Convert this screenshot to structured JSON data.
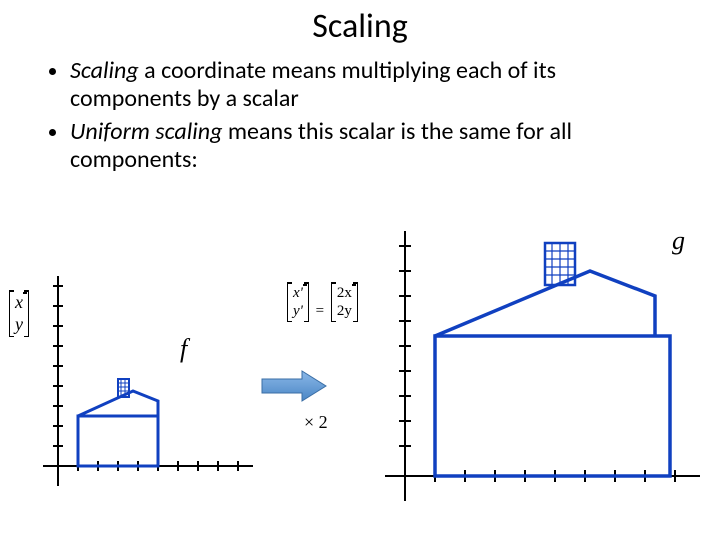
{
  "title": "Scaling",
  "bullets": [
    {
      "italic": "Scaling",
      "rest": " a coordinate means multiplying each of its components by a scalar"
    },
    {
      "italic": "Uniform scaling",
      "rest": " means this scalar is the same for all components:"
    }
  ],
  "labels": {
    "f": "f",
    "g": "g",
    "times2": "× 2"
  },
  "vector_xy": {
    "r1": "x",
    "r2": "y"
  },
  "equation": {
    "left": {
      "r1": "x'",
      "r2": "y'"
    },
    "eq": "=",
    "right": {
      "r1": "2x",
      "r2": "2y"
    }
  },
  "chart_data": {
    "type": "diagram",
    "description": "Two coordinate grids showing a house shape before and after uniform scaling by factor 2",
    "transform": "scale(2)",
    "matrix_equation": "[x'; y'] = [2x; 2y]",
    "left_grid": {
      "xrange": [
        -1,
        10
      ],
      "yrange": [
        -1,
        10
      ],
      "shape": "house",
      "approx_width": 5,
      "approx_height": 4,
      "label": "f"
    },
    "right_grid": {
      "xrange": [
        -1,
        10
      ],
      "yrange": [
        -1,
        10
      ],
      "shape": "house",
      "approx_width": 10,
      "approx_height": 8,
      "label": "g"
    },
    "scale_factor": 2
  }
}
